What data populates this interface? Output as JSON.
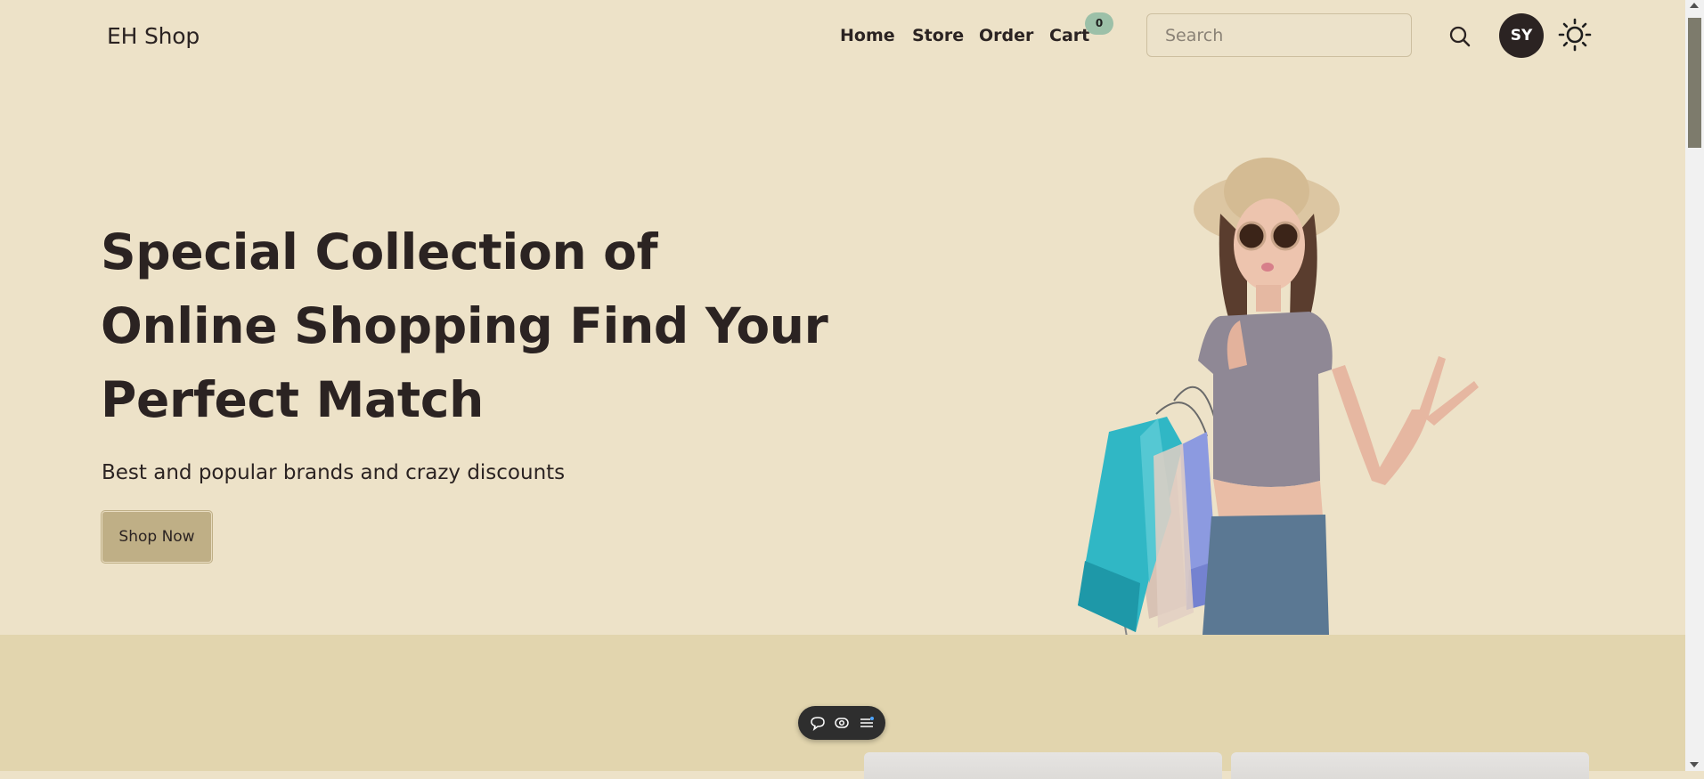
{
  "header": {
    "brand": "EH Shop",
    "nav": {
      "home": "Home",
      "store": "Store",
      "order": "Order",
      "cart": "Cart"
    },
    "cart_count": "0",
    "search": {
      "placeholder": "Search",
      "value": ""
    },
    "avatar_initials": "SY",
    "icons": {
      "search": "search-icon",
      "theme": "sun-icon"
    }
  },
  "hero": {
    "title": "Special Collection of Online Shopping Find Your Perfect Match",
    "subtitle": "Best and popular brands and crazy discounts",
    "cta": "Shop Now",
    "image": "woman-with-shopping-bags"
  },
  "toolbar": {
    "icons": [
      "comment-icon",
      "eye-icon",
      "menu-icon"
    ]
  },
  "colors": {
    "background": "#ede2c8",
    "section_background": "#e2d5ae",
    "text": "#2b2322",
    "button": "#bfaf86",
    "badge": "#9cc0a8",
    "avatar": "#2b2322",
    "toolbar": "#2e2e2e"
  }
}
